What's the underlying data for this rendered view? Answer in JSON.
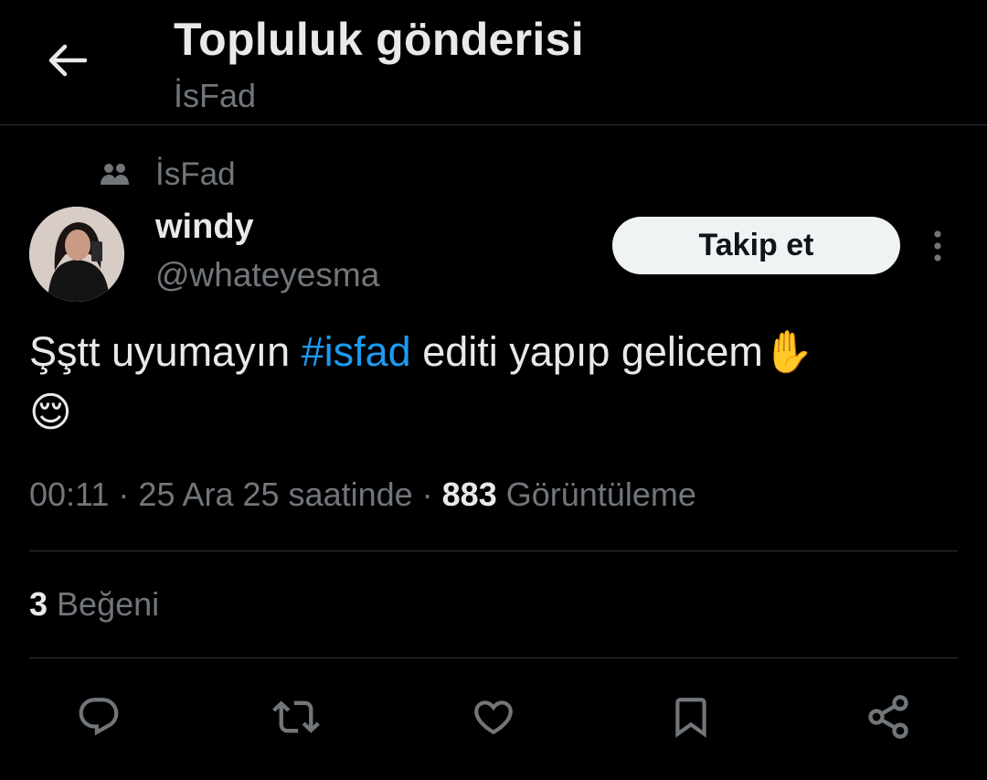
{
  "header": {
    "title": "Topluluk gönderisi",
    "subtitle": "İsFad"
  },
  "community": {
    "name": "İsFad",
    "icon": "community-icon"
  },
  "author": {
    "name": "windy",
    "handle": "@whateyesma",
    "follow_label": "Takip et"
  },
  "post": {
    "text_before": "Şştt uyumayın ",
    "hashtag": "#isfad",
    "text_after": " editi yapıp gelicem",
    "emoji_hand": "✋",
    "emoji_face": "😌"
  },
  "meta": {
    "time": "00:11",
    "sep1": " · ",
    "date": "25 Ara 25 saatinde",
    "sep2": " · ",
    "views_count": "883",
    "views_label": " Görüntüleme"
  },
  "likes": {
    "count": "3",
    "label": " Beğeni"
  },
  "actions": [
    "reply-icon",
    "retweet-icon",
    "like-icon",
    "bookmark-icon",
    "share-icon"
  ],
  "colors": {
    "background": "#000000",
    "text_primary": "#e7e9ea",
    "text_secondary": "#71767b",
    "accent": "#1d9bf0",
    "divider": "#2f3336",
    "follow_button_bg": "#eff3f4"
  }
}
